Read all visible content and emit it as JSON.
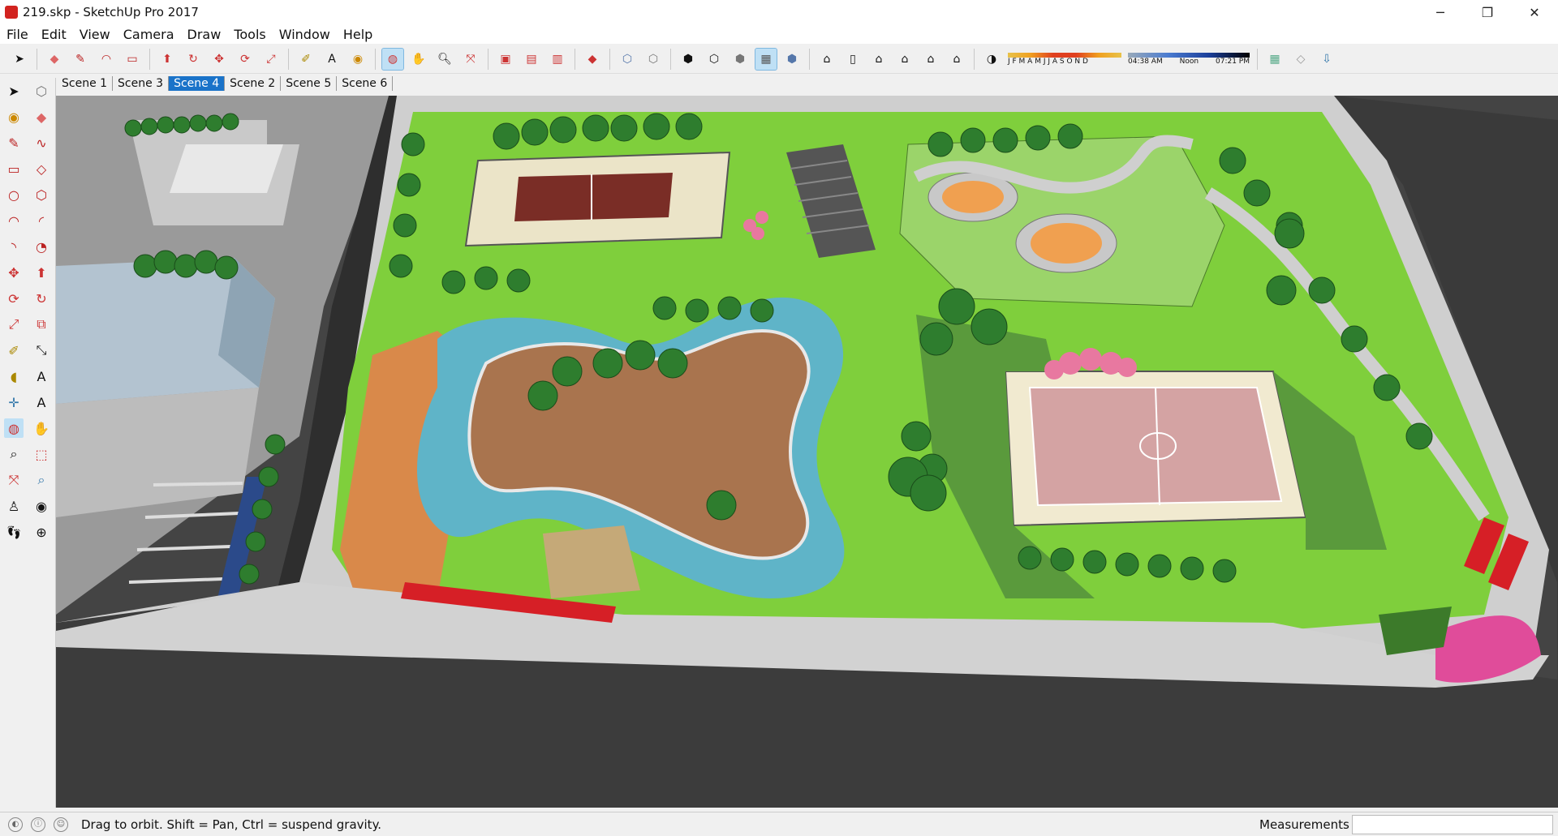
{
  "window": {
    "title": "219.skp - SketchUp Pro 2017",
    "minimize": "─",
    "restore": "❐",
    "close": "✕"
  },
  "menu": [
    "File",
    "Edit",
    "View",
    "Camera",
    "Draw",
    "Tools",
    "Window",
    "Help"
  ],
  "shadow": {
    "months": "J F M A M J J A S O N D",
    "time_start": "04:38 AM",
    "time_mid": "Noon",
    "time_end": "07:21 PM"
  },
  "scenes": [
    "Scene 1",
    "Scene 3",
    "Scene 4",
    "Scene 2",
    "Scene 5",
    "Scene 6"
  ],
  "active_scene": "Scene 4",
  "status": {
    "hint": "Drag to orbit. Shift = Pan, Ctrl = suspend gravity.",
    "measurements_label": "Measurements",
    "measurements_value": ""
  }
}
